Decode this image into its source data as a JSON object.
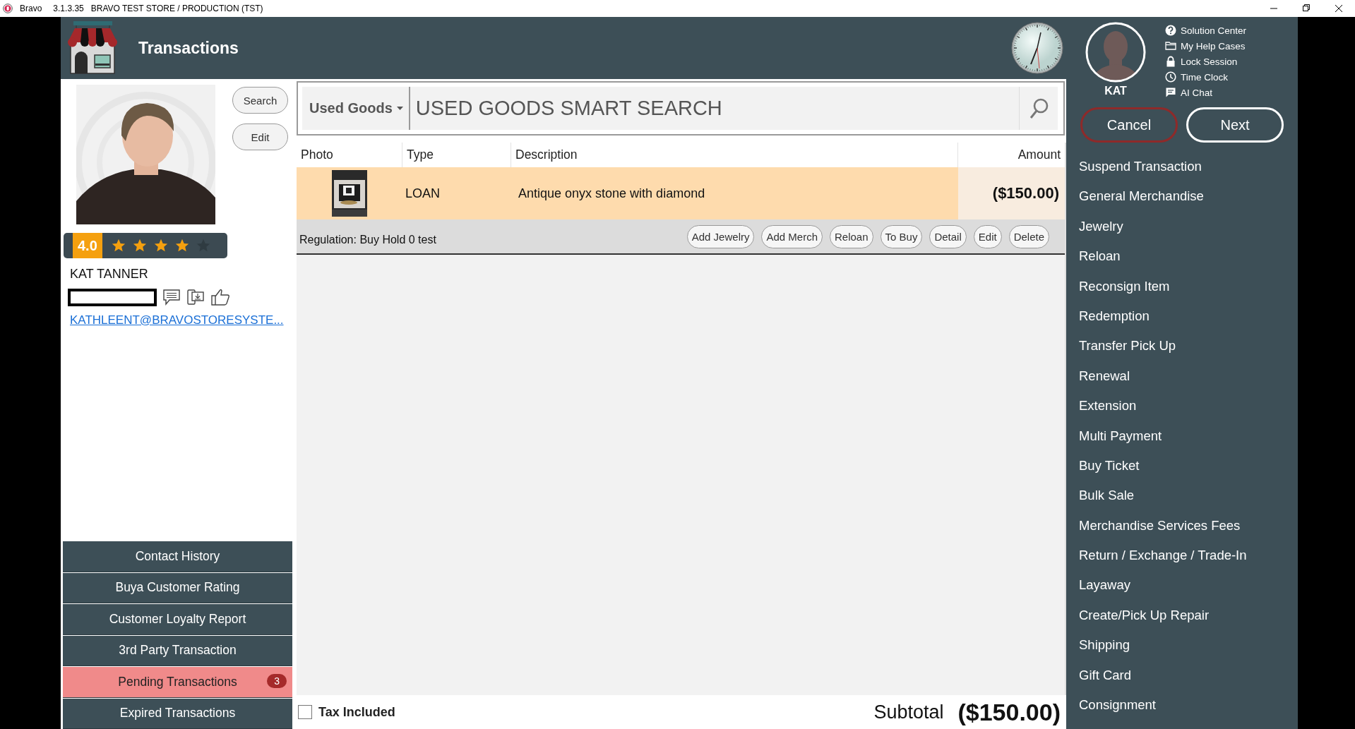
{
  "window": {
    "app_name": "Bravo",
    "version": "3.1.3.35",
    "store": "BRAVO TEST STORE / PRODUCTION (TST)"
  },
  "header": {
    "title": "Transactions"
  },
  "customer": {
    "buttons": [
      "Search",
      "Edit"
    ],
    "rating": "4.0",
    "stars": 4,
    "name": "KAT TANNER",
    "email": "KATHLEENT@BRAVOSTORESYSTE..."
  },
  "customer_menu": [
    {
      "label": "Contact History",
      "selected": false
    },
    {
      "label": "Buya Customer Rating",
      "selected": false
    },
    {
      "label": "Customer Loyalty Report",
      "selected": false
    },
    {
      "label": "3rd Party Transaction",
      "selected": false
    },
    {
      "label": "Pending Transactions",
      "selected": true,
      "badge": "3"
    },
    {
      "label": "Expired Transactions",
      "selected": false
    }
  ],
  "search": {
    "category": "Used Goods",
    "placeholder": "USED GOODS SMART SEARCH"
  },
  "table": {
    "columns": [
      "Photo",
      "Type",
      "Description",
      "Amount"
    ],
    "rows": [
      {
        "type": "LOAN",
        "description": "Antique onyx stone with diamond",
        "amount": "($150.00)",
        "selected": true
      }
    ]
  },
  "row_actions": {
    "note": "Regulation: Buy Hold 0 test",
    "buttons": [
      "Add Jewelry",
      "Add Merch",
      "Reloan",
      "To Buy",
      "Detail",
      "Edit",
      "Delete"
    ]
  },
  "footer": {
    "tax_included": {
      "label": "Tax Included",
      "checked": false
    },
    "subtotal_label": "Subtotal",
    "subtotal": "($150.00)"
  },
  "user": {
    "name": "KAT",
    "links": [
      {
        "label": "Solution Center",
        "kind": "help"
      },
      {
        "label": "My Help Cases",
        "kind": "folder"
      },
      {
        "label": "Lock Session",
        "kind": "lock"
      },
      {
        "label": "Time Clock",
        "kind": "clock"
      },
      {
        "label": "AI Chat",
        "kind": "chat"
      }
    ]
  },
  "actions": [
    {
      "label": "Cancel",
      "kind": "cancel"
    },
    {
      "label": "Next",
      "kind": "next"
    }
  ],
  "menu": [
    "Suspend Transaction",
    "General Merchandise",
    "Jewelry",
    "Reloan",
    "Reconsign Item",
    "Redemption",
    "Transfer Pick Up",
    "Renewal",
    "Extension",
    "Multi Payment",
    "Buy Ticket",
    "Bulk Sale",
    "Merchandise Services Fees",
    "Return / Exchange / Trade-In",
    "Layaway",
    "Create/Pick Up Repair",
    "Shipping",
    "Gift Card",
    "Consignment"
  ]
}
